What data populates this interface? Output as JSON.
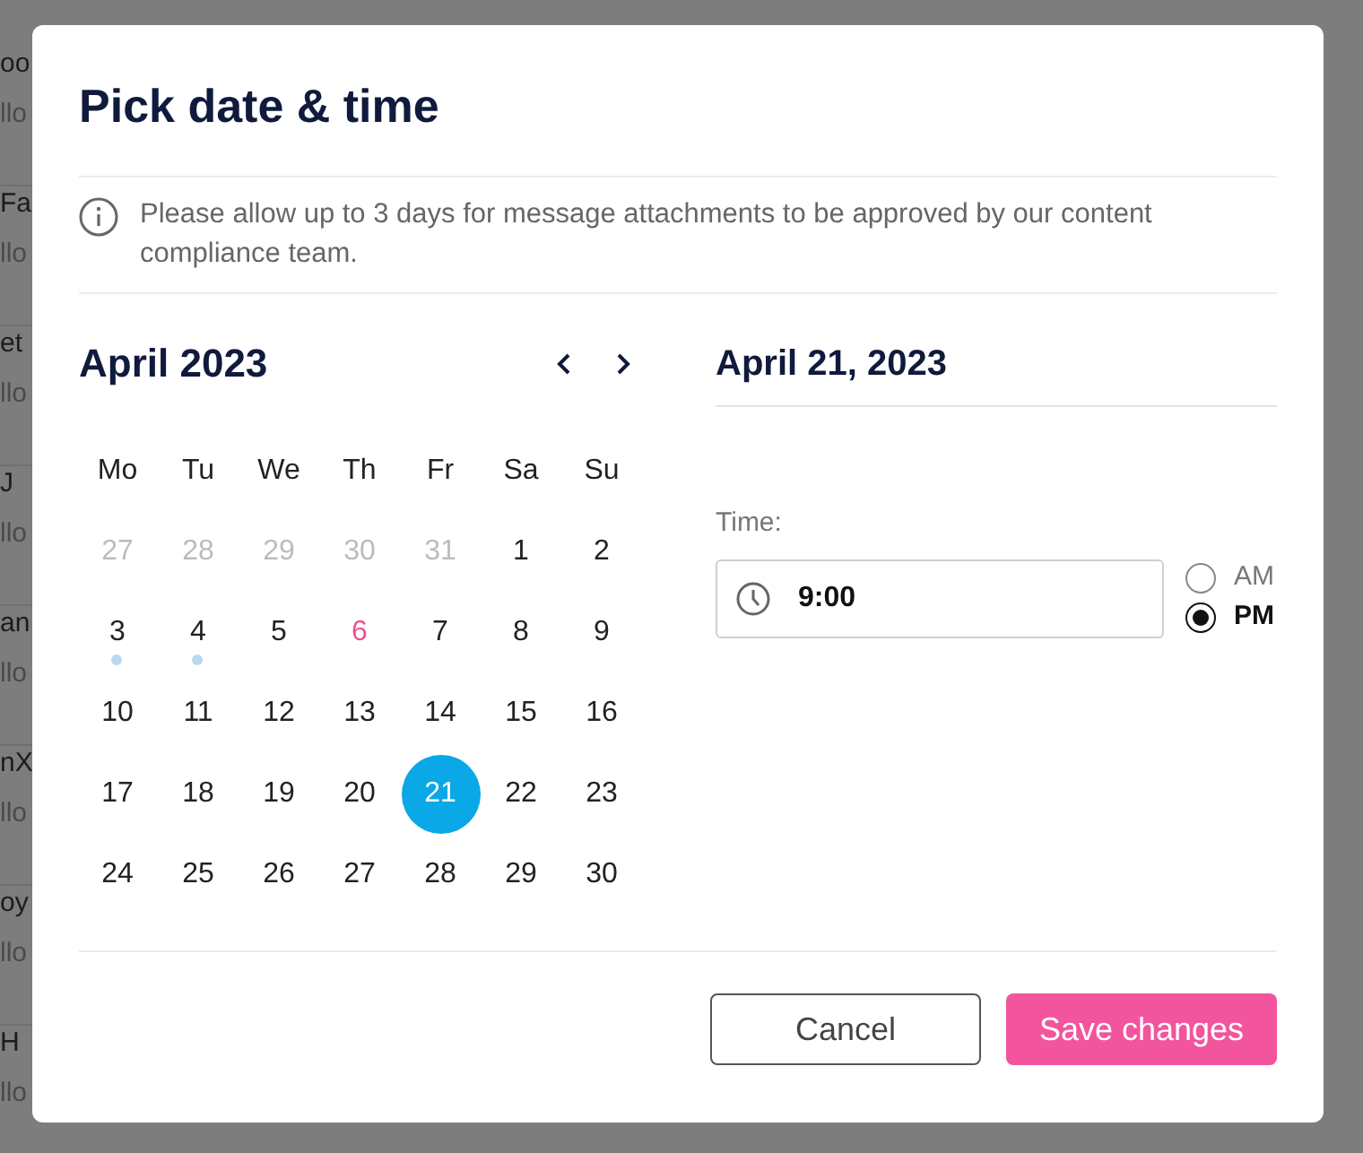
{
  "background_list": [
    {
      "name": "oo",
      "subtitle": "llo"
    },
    {
      "name": "Fa",
      "subtitle": "llo"
    },
    {
      "name": "et",
      "subtitle": "llo"
    },
    {
      "name": "J",
      "subtitle": "llo"
    },
    {
      "name": "an",
      "subtitle": "llo"
    },
    {
      "name": "nX",
      "subtitle": "llo"
    },
    {
      "name": "oy",
      "subtitle": "llo"
    },
    {
      "name": "H",
      "subtitle": "llo"
    }
  ],
  "dialog": {
    "title": "Pick date & time",
    "notice": "Please allow up to 3 days for message attachments to be approved by our content compliance team.",
    "calendar": {
      "month": "April 2023",
      "weekdays": [
        "Mo",
        "Tu",
        "We",
        "Th",
        "Fr",
        "Sa",
        "Su"
      ],
      "days": [
        {
          "label": "27",
          "outside": true,
          "today": false,
          "event": false,
          "selected": false
        },
        {
          "label": "28",
          "outside": true,
          "today": false,
          "event": false,
          "selected": false
        },
        {
          "label": "29",
          "outside": true,
          "today": false,
          "event": false,
          "selected": false
        },
        {
          "label": "30",
          "outside": true,
          "today": false,
          "event": false,
          "selected": false
        },
        {
          "label": "31",
          "outside": true,
          "today": false,
          "event": false,
          "selected": false
        },
        {
          "label": "1",
          "outside": false,
          "today": false,
          "event": false,
          "selected": false
        },
        {
          "label": "2",
          "outside": false,
          "today": false,
          "event": false,
          "selected": false
        },
        {
          "label": "3",
          "outside": false,
          "today": false,
          "event": true,
          "selected": false
        },
        {
          "label": "4",
          "outside": false,
          "today": false,
          "event": true,
          "selected": false
        },
        {
          "label": "5",
          "outside": false,
          "today": false,
          "event": false,
          "selected": false
        },
        {
          "label": "6",
          "outside": false,
          "today": true,
          "event": false,
          "selected": false
        },
        {
          "label": "7",
          "outside": false,
          "today": false,
          "event": false,
          "selected": false
        },
        {
          "label": "8",
          "outside": false,
          "today": false,
          "event": false,
          "selected": false
        },
        {
          "label": "9",
          "outside": false,
          "today": false,
          "event": false,
          "selected": false
        },
        {
          "label": "10",
          "outside": false,
          "today": false,
          "event": false,
          "selected": false
        },
        {
          "label": "11",
          "outside": false,
          "today": false,
          "event": false,
          "selected": false
        },
        {
          "label": "12",
          "outside": false,
          "today": false,
          "event": false,
          "selected": false
        },
        {
          "label": "13",
          "outside": false,
          "today": false,
          "event": false,
          "selected": false
        },
        {
          "label": "14",
          "outside": false,
          "today": false,
          "event": false,
          "selected": false
        },
        {
          "label": "15",
          "outside": false,
          "today": false,
          "event": false,
          "selected": false
        },
        {
          "label": "16",
          "outside": false,
          "today": false,
          "event": false,
          "selected": false
        },
        {
          "label": "17",
          "outside": false,
          "today": false,
          "event": false,
          "selected": false
        },
        {
          "label": "18",
          "outside": false,
          "today": false,
          "event": false,
          "selected": false
        },
        {
          "label": "19",
          "outside": false,
          "today": false,
          "event": false,
          "selected": false
        },
        {
          "label": "20",
          "outside": false,
          "today": false,
          "event": false,
          "selected": false
        },
        {
          "label": "21",
          "outside": false,
          "today": false,
          "event": false,
          "selected": true
        },
        {
          "label": "22",
          "outside": false,
          "today": false,
          "event": false,
          "selected": false
        },
        {
          "label": "23",
          "outside": false,
          "today": false,
          "event": false,
          "selected": false
        },
        {
          "label": "24",
          "outside": false,
          "today": false,
          "event": false,
          "selected": false
        },
        {
          "label": "25",
          "outside": false,
          "today": false,
          "event": false,
          "selected": false
        },
        {
          "label": "26",
          "outside": false,
          "today": false,
          "event": false,
          "selected": false
        },
        {
          "label": "27",
          "outside": false,
          "today": false,
          "event": false,
          "selected": false
        },
        {
          "label": "28",
          "outside": false,
          "today": false,
          "event": false,
          "selected": false
        },
        {
          "label": "29",
          "outside": false,
          "today": false,
          "event": false,
          "selected": false
        },
        {
          "label": "30",
          "outside": false,
          "today": false,
          "event": false,
          "selected": false
        }
      ]
    },
    "selected_date": "April 21, 2023",
    "time": {
      "label": "Time:",
      "value": "9:00",
      "periods": [
        {
          "label": "AM",
          "selected": false
        },
        {
          "label": "PM",
          "selected": true
        }
      ]
    },
    "buttons": {
      "cancel": "Cancel",
      "save": "Save changes"
    }
  }
}
